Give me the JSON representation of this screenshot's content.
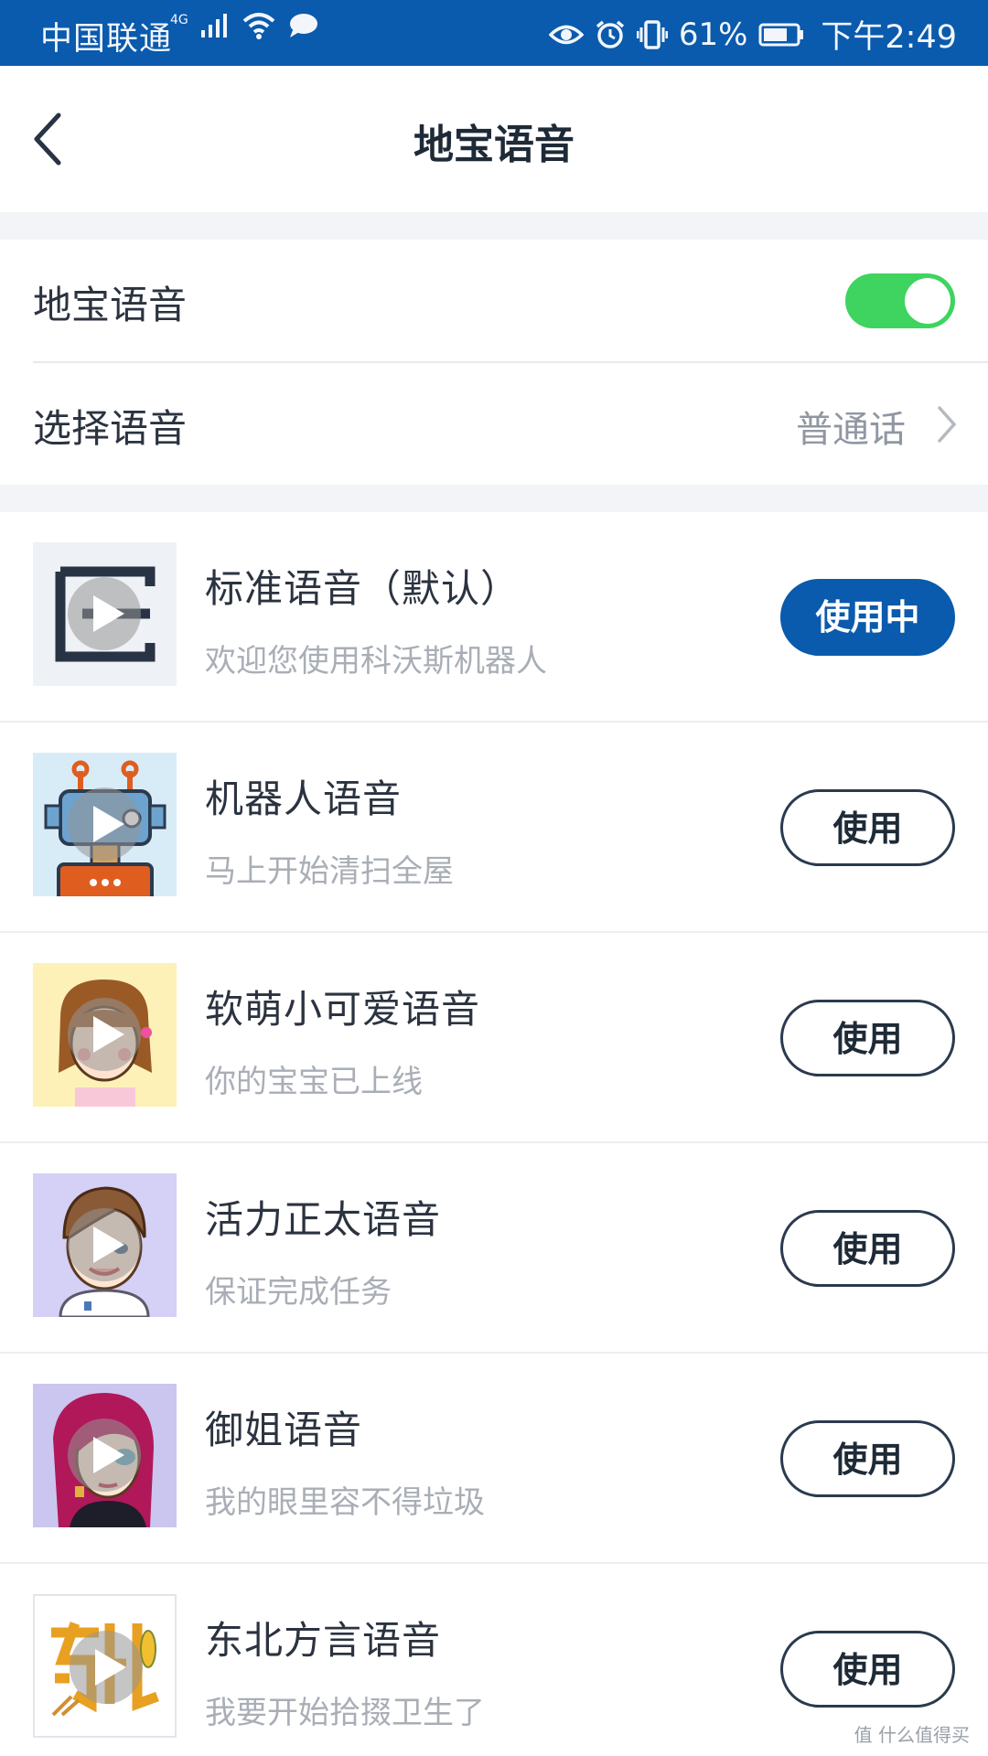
{
  "status_bar": {
    "carrier": "中国联通",
    "network": "4G",
    "battery_percent": "61%",
    "time": "下午2:49"
  },
  "header": {
    "title": "地宝语音"
  },
  "settings": {
    "voice_toggle_label": "地宝语音",
    "voice_toggle_on": true,
    "select_voice_label": "选择语音",
    "select_voice_value": "普通话"
  },
  "voices": [
    {
      "name": "标准语音（默认）",
      "desc": "欢迎您使用科沃斯机器人",
      "button": "使用中",
      "active": true,
      "thumb": "standard-logo"
    },
    {
      "name": "机器人语音",
      "desc": "马上开始清扫全屋",
      "button": "使用",
      "active": false,
      "thumb": "robot-avatar"
    },
    {
      "name": "软萌小可爱语音",
      "desc": "你的宝宝已上线",
      "button": "使用",
      "active": false,
      "thumb": "cute-girl-avatar"
    },
    {
      "name": "活力正太语音",
      "desc": "保证完成任务",
      "button": "使用",
      "active": false,
      "thumb": "boy-avatar"
    },
    {
      "name": "御姐语音",
      "desc": "我的眼里容不得垃圾",
      "button": "使用",
      "active": false,
      "thumb": "lady-avatar"
    },
    {
      "name": "东北方言语音",
      "desc": "我要开始拾掇卫生了",
      "button": "使用",
      "active": false,
      "thumb": "northeast-dialect-logo"
    }
  ],
  "watermark": "值 什么值得买",
  "colors": {
    "brand_blue": "#0a5aad",
    "toggle_green": "#3ed45f"
  }
}
